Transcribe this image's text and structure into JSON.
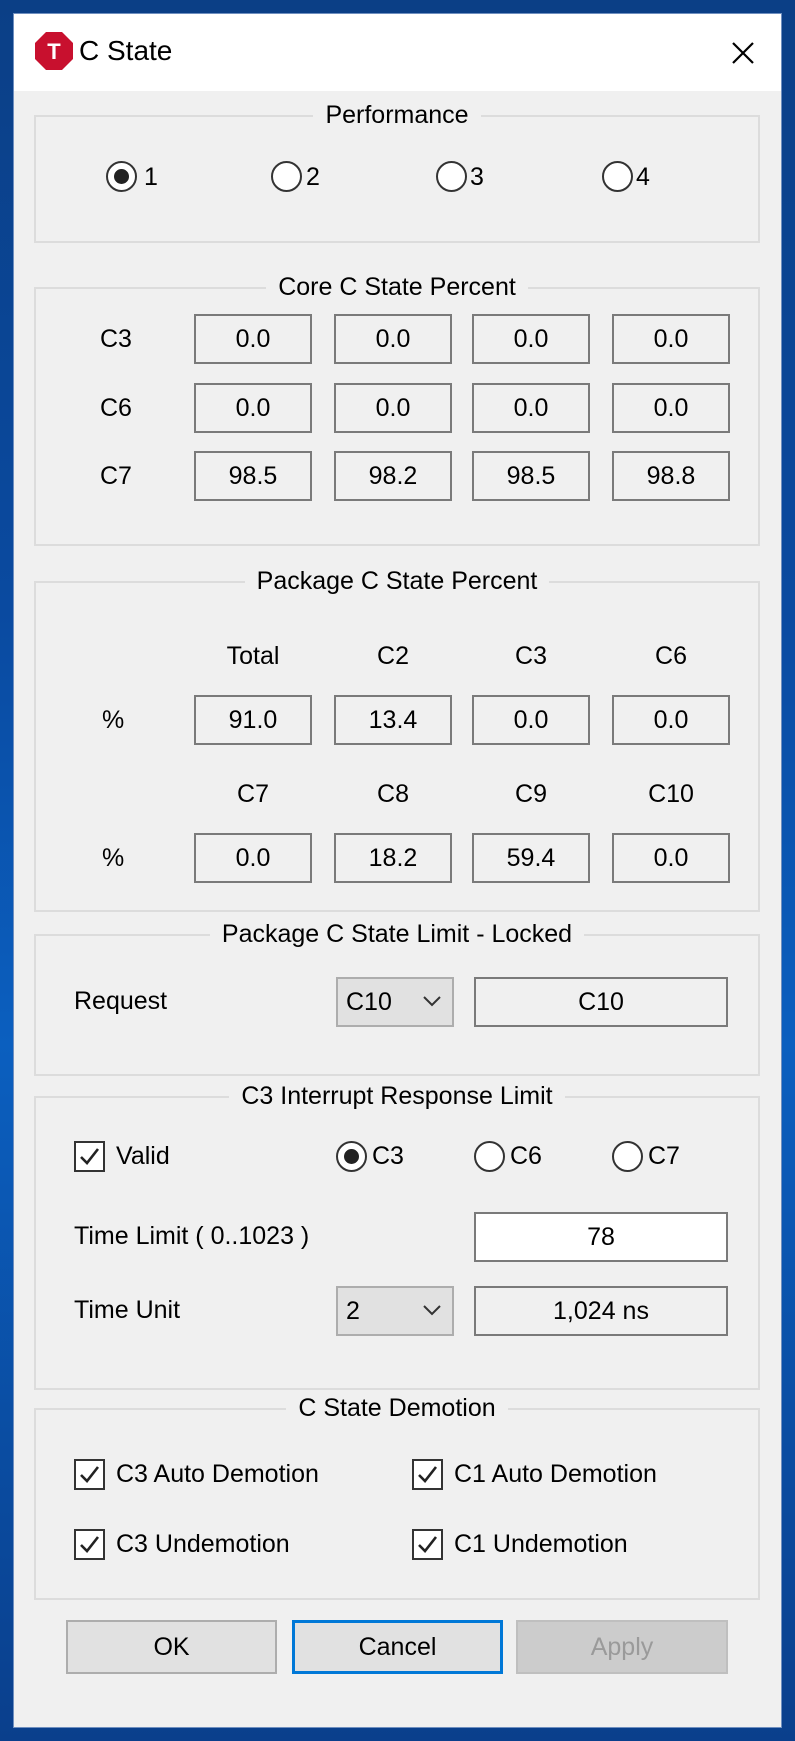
{
  "window": {
    "title": "C State",
    "logo_letter": "T",
    "logo_color": "#c8102e",
    "close_glyph": "✕"
  },
  "performance": {
    "legend": "Performance",
    "options": [
      "1",
      "2",
      "3",
      "4"
    ],
    "selected": "1"
  },
  "core_c_state": {
    "legend": "Core C State Percent",
    "rows": [
      {
        "label": "C3",
        "values": [
          "0.0",
          "0.0",
          "0.0",
          "0.0"
        ]
      },
      {
        "label": "C6",
        "values": [
          "0.0",
          "0.0",
          "0.0",
          "0.0"
        ]
      },
      {
        "label": "C7",
        "values": [
          "98.5",
          "98.2",
          "98.5",
          "98.8"
        ]
      }
    ]
  },
  "package_c_state": {
    "legend": "Package C State Percent",
    "row_label": "%",
    "headers1": [
      "Total",
      "C2",
      "C3",
      "C6"
    ],
    "values1": [
      "91.0",
      "13.4",
      "0.0",
      "0.0"
    ],
    "headers2": [
      "C7",
      "C8",
      "C9",
      "C10"
    ],
    "values2": [
      "0.0",
      "18.2",
      "59.4",
      "0.0"
    ]
  },
  "package_limit": {
    "legend": "Package C State Limit - Locked",
    "request_label": "Request",
    "request_value": "C10",
    "request_display": "C10"
  },
  "interrupt": {
    "legend": "C3 Interrupt Response Limit",
    "valid_label": "Valid",
    "valid_checked": true,
    "options": [
      "C3",
      "C6",
      "C7"
    ],
    "selected": "C3",
    "time_limit_label": "Time Limit  ( 0..1023 )",
    "time_limit_value": "78",
    "time_unit_label": "Time Unit",
    "time_unit_value": "2",
    "time_unit_display": "1,024 ns"
  },
  "demotion": {
    "legend": "C State Demotion",
    "c3_auto": "C3 Auto Demotion",
    "c1_auto": "C1 Auto Demotion",
    "c3_undemotion": "C3 Undemotion",
    "c1_undemotion": "C1 Undemotion"
  },
  "buttons": {
    "ok": "OK",
    "cancel": "Cancel",
    "apply": "Apply"
  }
}
